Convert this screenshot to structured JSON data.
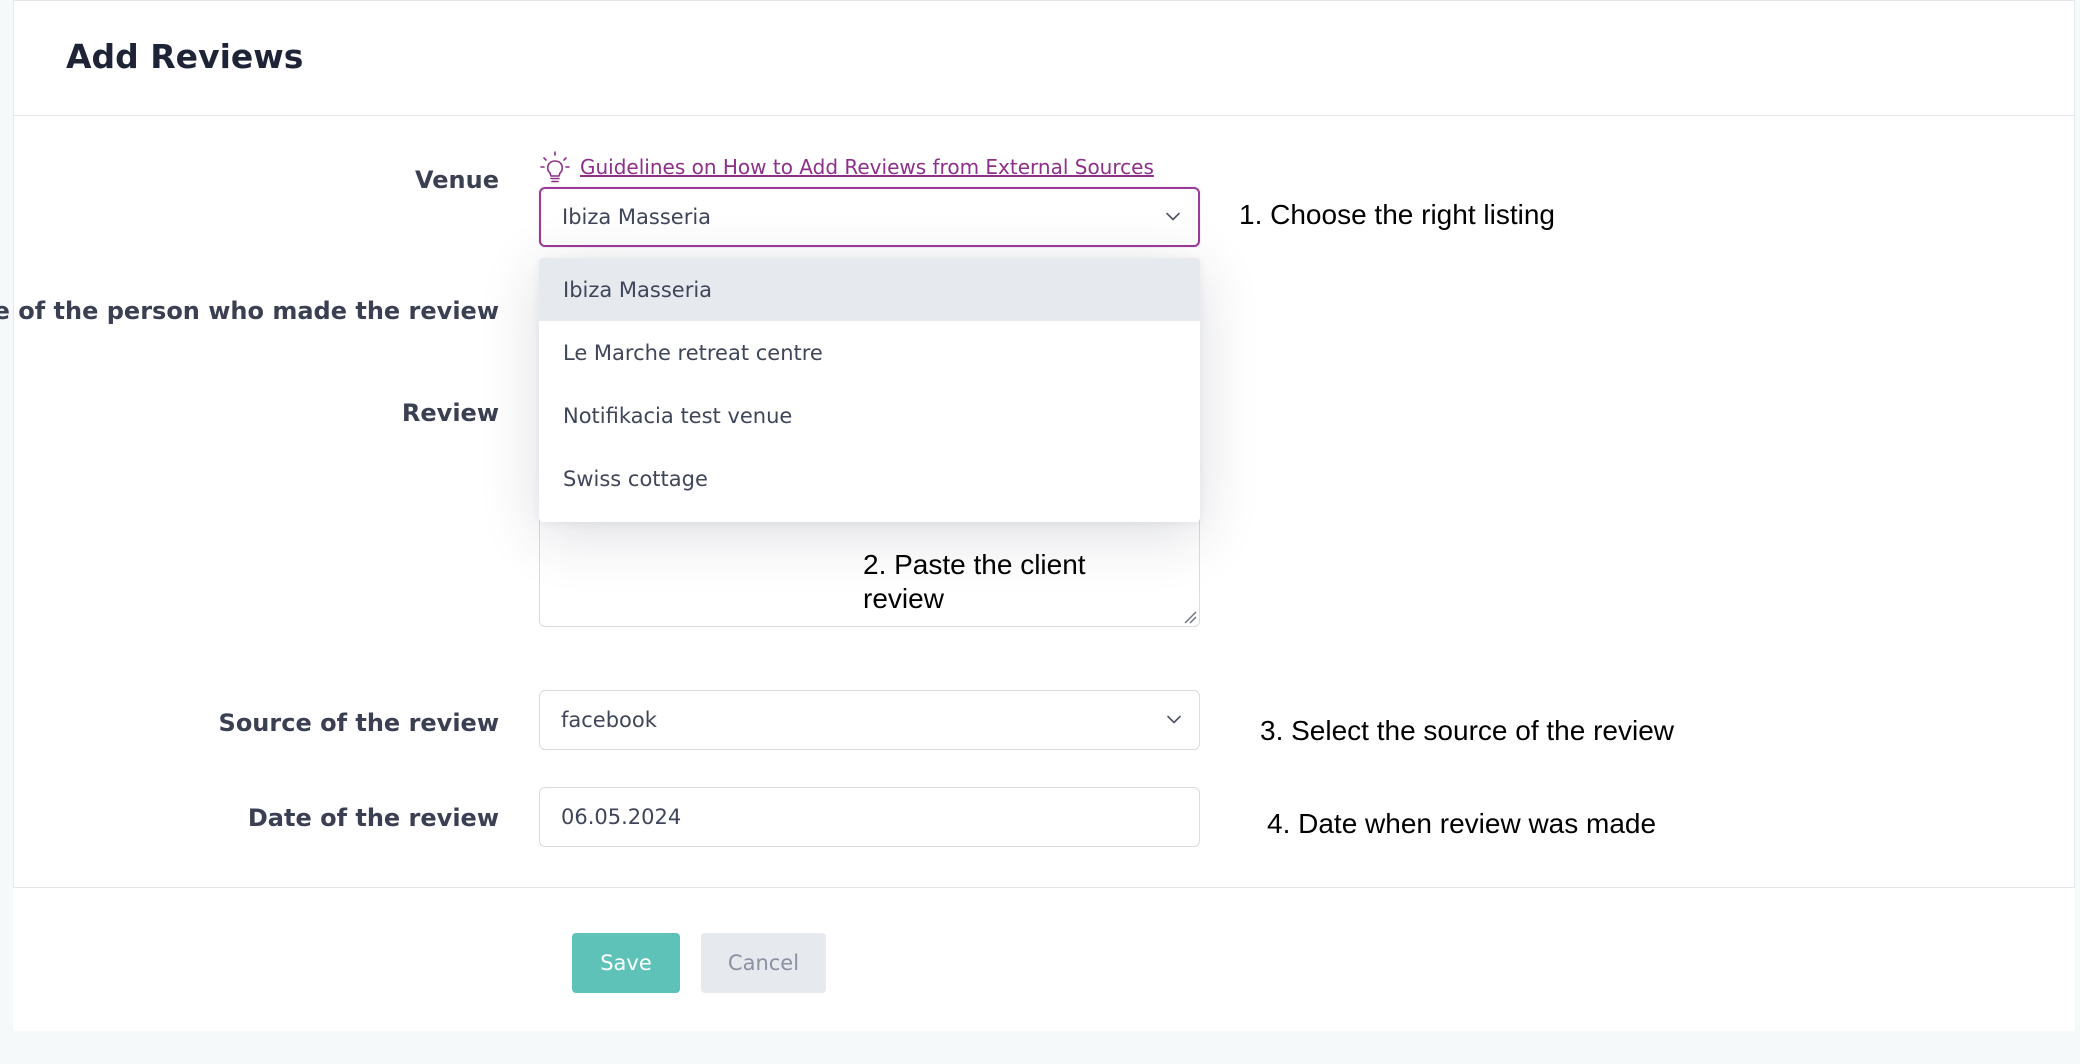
{
  "header": {
    "title": "Add Reviews"
  },
  "form": {
    "venue": {
      "label": "Venue",
      "guideline_link": "Guidelines on How to Add Reviews from External Sources",
      "selected": "Ibiza Masseria",
      "options": [
        "Ibiza Masseria",
        "Le Marche retreat centre",
        "Notifikacia test venue",
        "Swiss cottage"
      ]
    },
    "reviewer_name": {
      "label": "Name of the person who made the review"
    },
    "review": {
      "label": "Review",
      "value": ""
    },
    "source": {
      "label": "Source of the review",
      "selected": "facebook"
    },
    "date": {
      "label": "Date of the review",
      "value": "06.05.2024"
    }
  },
  "annotations": {
    "step1": "1. Choose the right listing",
    "step2": "2. Paste the client review",
    "step3": "3. Select the source of the review",
    "step4": "4. Date when review was made"
  },
  "actions": {
    "save": "Save",
    "cancel": "Cancel"
  },
  "colors": {
    "accent": "#9c3a9a",
    "link": "#8e2f8a",
    "save_button": "#5ec2b8",
    "cancel_button": "#e6e9ee",
    "selected_option_bg": "#e6e9ee"
  },
  "icons": {
    "guideline": "lightbulb-icon",
    "select_arrow": "chevron-down-icon",
    "textarea_resize": "resize-handle-icon"
  }
}
